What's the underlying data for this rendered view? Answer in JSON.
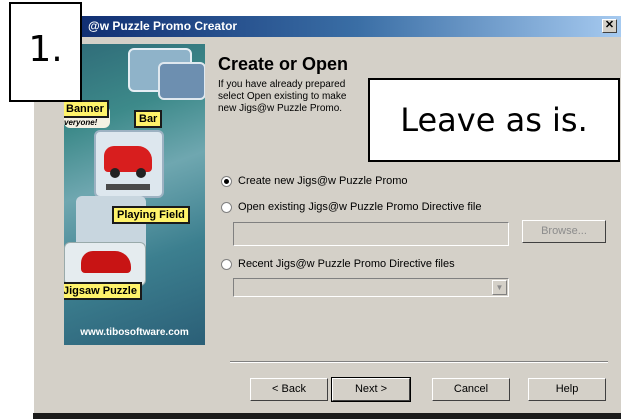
{
  "window": {
    "title": "Jigs@w Puzzle Promo Creator",
    "title_visible": "@w Puzzle Promo Creator",
    "close_glyph": "✕"
  },
  "side_image": {
    "labels": {
      "banner": "Banner",
      "everyone": "veryone!",
      "bar": "Bar",
      "playing_field": "Playing Field",
      "jigsaw_puzzle": "Jigsaw Puzzle"
    },
    "url": "www.tibosoftware.com"
  },
  "page": {
    "heading": "Create or Open",
    "description_lines": [
      "If you have already prepared",
      "select Open existing to make",
      "new Jigs@w Puzzle Promo."
    ]
  },
  "options": {
    "create_new": {
      "label": "Create new Jigs@w Puzzle Promo",
      "selected": true
    },
    "open_existing": {
      "label": "Open existing Jigs@w Puzzle Promo Directive file",
      "selected": false
    },
    "recent": {
      "label": "Recent Jigs@w Puzzle Promo Directive files",
      "selected": false
    }
  },
  "open_path_value": "",
  "recent_value": "",
  "buttons": {
    "browse": "Browse...",
    "back": "< Back",
    "next": "Next >",
    "cancel": "Cancel",
    "help": "Help"
  },
  "annotations": {
    "step": "1.",
    "note": "Leave as is."
  }
}
